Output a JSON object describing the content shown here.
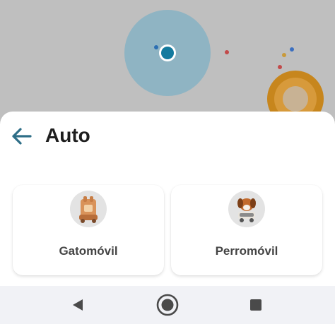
{
  "colors": {
    "accent": "#2e6e87",
    "location_dot": "#1b9ac4",
    "location_halo": "#8ec5dd",
    "destination_marker": "#f2a31b",
    "poi_red": "#e64545",
    "poi_blue": "#3b7fd8",
    "poi_orange": "#f0a030"
  },
  "map": {
    "icons": [
      "current-location-icon",
      "destination-marker-icon",
      "map-poi-icon"
    ]
  },
  "sheet": {
    "back_icon": "arrow-left-icon",
    "title": "Auto",
    "options": [
      {
        "label": "Gatomóvil",
        "icon": "cat-car-icon"
      },
      {
        "label": "Perromóvil",
        "icon": "dog-car-icon"
      }
    ]
  },
  "navbar": {
    "icons": [
      "nav-back-icon",
      "nav-home-icon",
      "nav-recents-icon"
    ]
  }
}
